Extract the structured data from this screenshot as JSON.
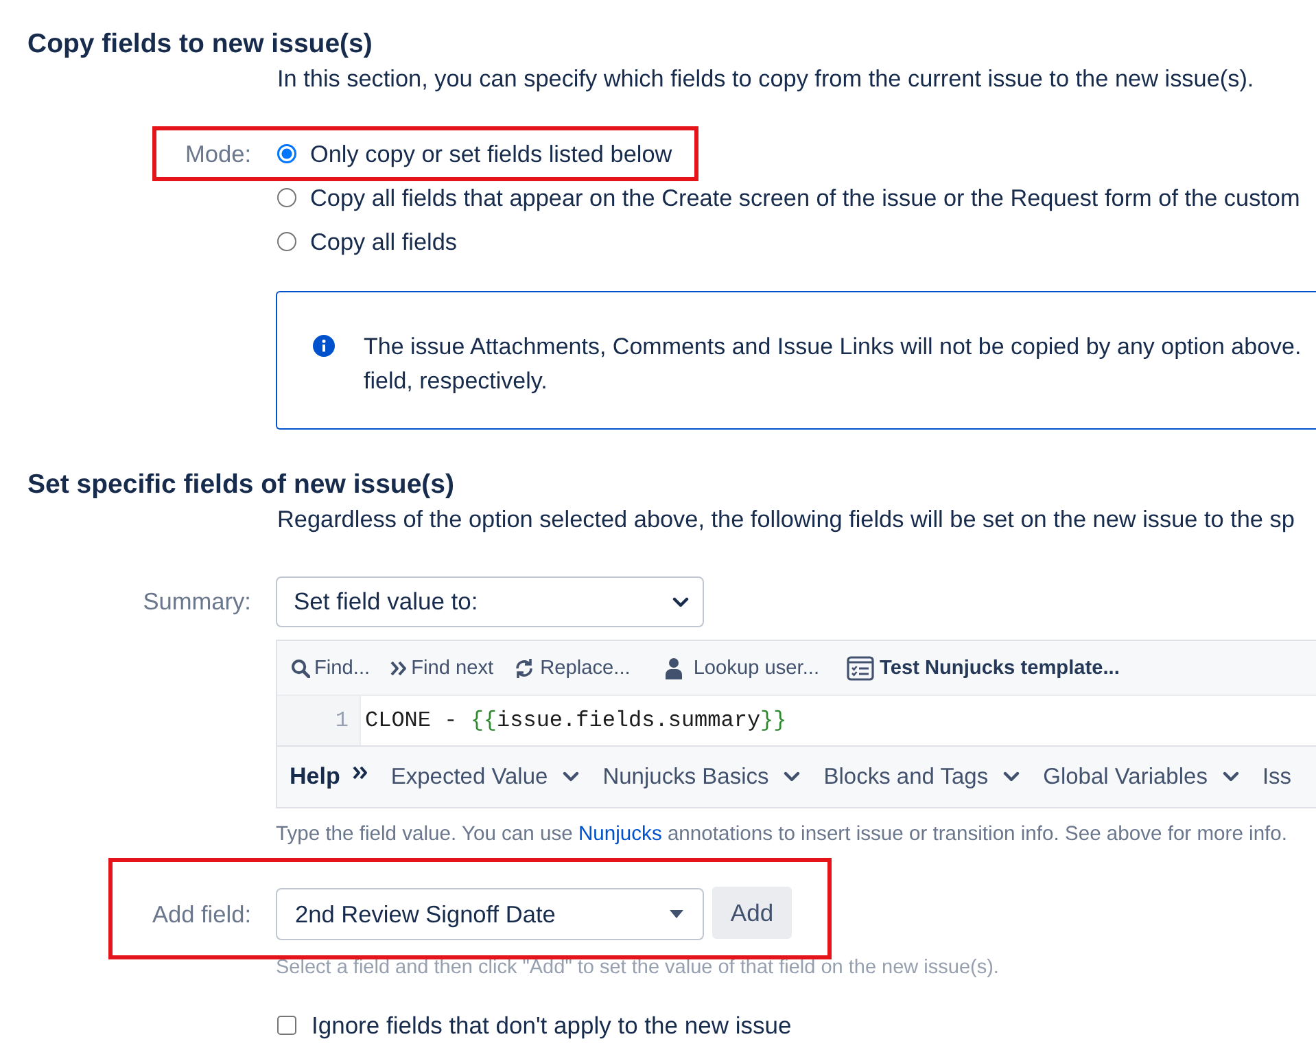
{
  "copy_section": {
    "title": "Copy fields to new issue(s)",
    "description": "In this section, you can specify which fields to copy from the current issue to the new issue(s).",
    "mode": {
      "label": "Mode:",
      "highlighted": true,
      "options": [
        {
          "label": "Only copy or set fields listed below",
          "selected": true
        },
        {
          "label": "Copy all fields that appear on the Create screen of the issue or the Request form of the custom",
          "selected": false
        },
        {
          "label": "Copy all fields",
          "selected": false
        }
      ]
    },
    "info": {
      "lines": [
        "The issue Attachments, Comments and Issue Links will not be copied by any option above.",
        "field, respectively."
      ]
    }
  },
  "set_section": {
    "title": "Set specific fields of new issue(s)",
    "description": "Regardless of the option selected above, the following fields will be set on the new issue to the sp",
    "summary": {
      "label": "Summary:",
      "select_value": "Set field value to:",
      "editor": {
        "toolbar": [
          {
            "kind": "search",
            "label": "Find..."
          },
          {
            "kind": "next",
            "label": "Find next"
          },
          {
            "kind": "replace",
            "label": "Replace..."
          },
          {
            "kind": "user",
            "label": "Lookup user..."
          },
          {
            "kind": "template",
            "label": "Test Nunjucks template..."
          }
        ],
        "lines": [
          {
            "number": "1",
            "tokens": [
              {
                "kind": "text",
                "text": "CLONE - "
              },
              {
                "kind": "bracket",
                "text": "{{"
              },
              {
                "kind": "text",
                "text": "issue.fields.summary"
              },
              {
                "kind": "bracket",
                "text": "}}"
              }
            ]
          }
        ],
        "help": {
          "label": "Help",
          "menus": [
            {
              "label": "Expected Value",
              "caret": true
            },
            {
              "label": "Nunjucks Basics",
              "caret": true
            },
            {
              "label": "Blocks and Tags",
              "caret": true
            },
            {
              "label": "Global Variables",
              "caret": true
            },
            {
              "label": "Iss",
              "caret": false
            }
          ]
        }
      },
      "hint": {
        "before": "Type the field value. You can use ",
        "link": "Nunjucks",
        "after": " annotations to insert issue or transition info. See above for more info."
      }
    },
    "add_field": {
      "label": "Add field:",
      "highlighted": true,
      "value": "2nd Review Signoff Date",
      "button": "Add",
      "hint": "Select a field and then click \"Add\" to set the value of that field on the new issue(s)."
    },
    "ignore_option": {
      "label": "Ignore fields that don't apply to the new issue",
      "checked": false
    }
  }
}
